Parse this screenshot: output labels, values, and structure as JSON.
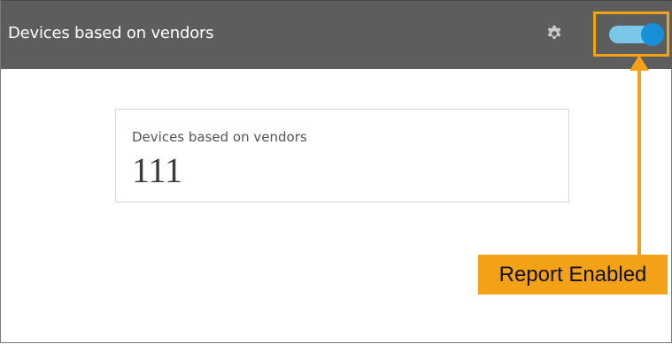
{
  "header": {
    "title": "Devices based on vendors",
    "settings_icon": "gear-icon",
    "toggle_state": "on",
    "toggle_color": "#1790d9"
  },
  "card": {
    "title": "Devices based on vendors",
    "value": "111"
  },
  "annotation": {
    "label": "Report Enabled",
    "color": "#f3a217"
  }
}
